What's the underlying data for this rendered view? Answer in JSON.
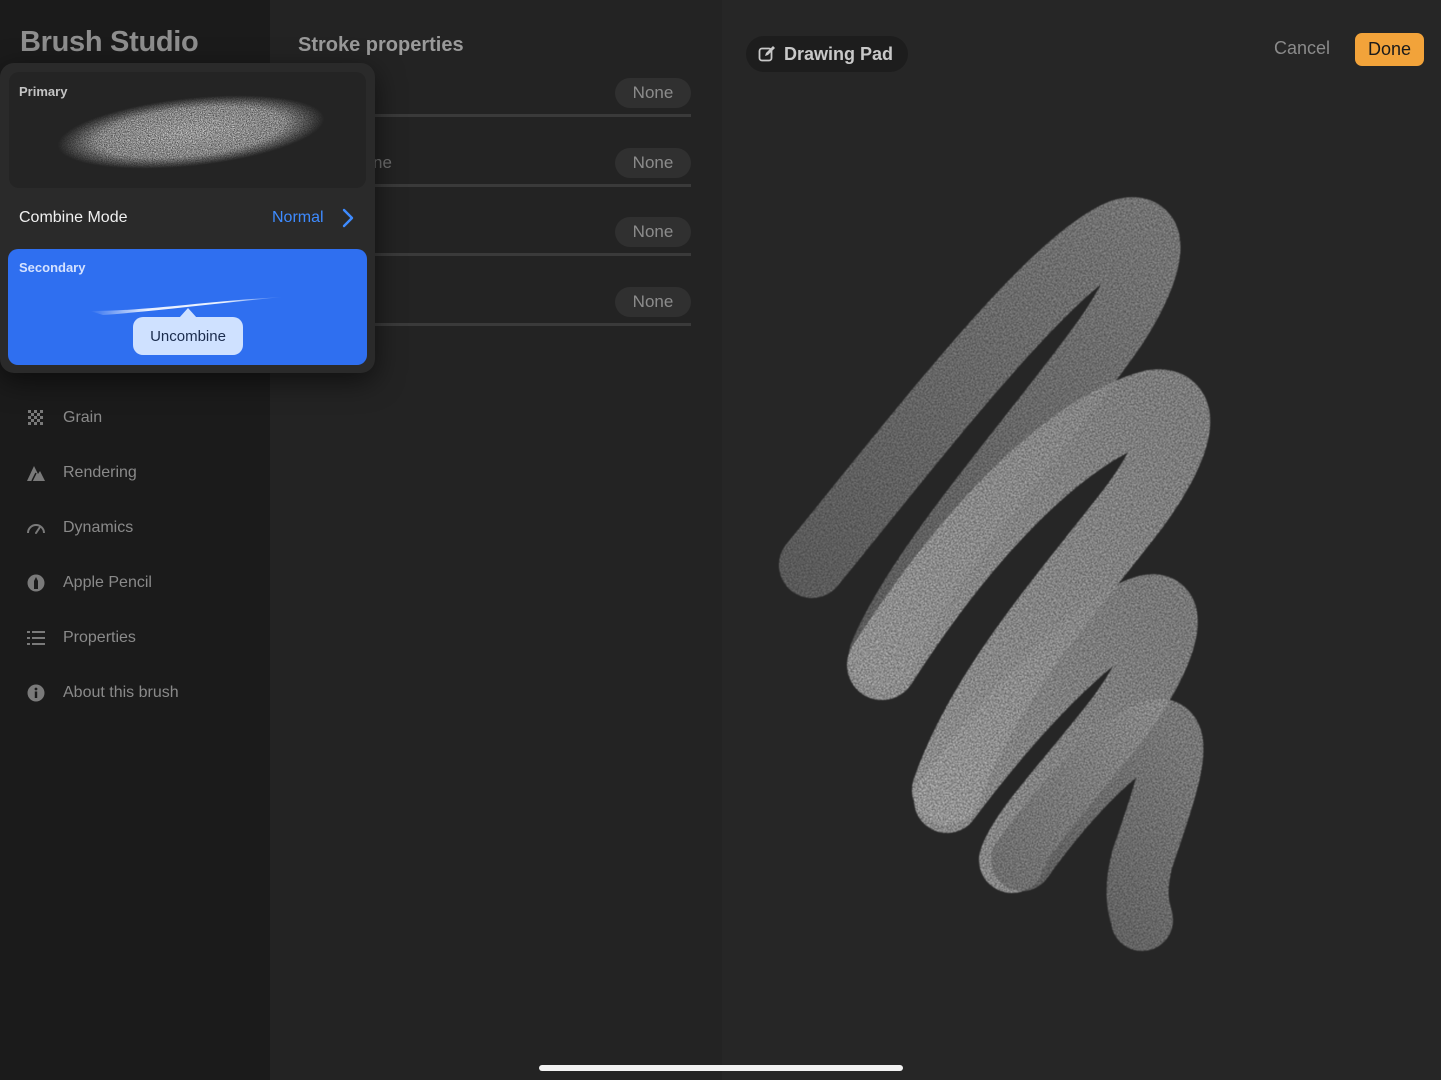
{
  "app": {
    "title": "Brush Studio"
  },
  "sidebar": {
    "items": [
      {
        "label": "Grain",
        "icon": "grain-icon"
      },
      {
        "label": "Rendering",
        "icon": "rendering-icon"
      },
      {
        "label": "Dynamics",
        "icon": "dynamics-icon"
      },
      {
        "label": "Apple Pencil",
        "icon": "apple-pencil-icon"
      },
      {
        "label": "Properties",
        "icon": "properties-icon"
      },
      {
        "label": "About this brush",
        "icon": "info-icon"
      }
    ]
  },
  "main": {
    "section_title": "Stroke properties",
    "rows": [
      {
        "label": "",
        "value": "None"
      },
      {
        "label": "ne",
        "value": "None"
      },
      {
        "label": "",
        "value": "None"
      },
      {
        "label": "",
        "value": "None"
      }
    ]
  },
  "popover": {
    "primary_label": "Primary",
    "combine_mode_label": "Combine Mode",
    "combine_mode_value": "Normal",
    "secondary_label": "Secondary",
    "uncombine_label": "Uncombine"
  },
  "drawing_pad": {
    "label": "Drawing Pad",
    "cancel_label": "Cancel",
    "done_label": "Done"
  },
  "colors": {
    "accent_blue": "#2f6ff0",
    "link_blue": "#3e8bff",
    "done_orange": "#f2a33a"
  }
}
